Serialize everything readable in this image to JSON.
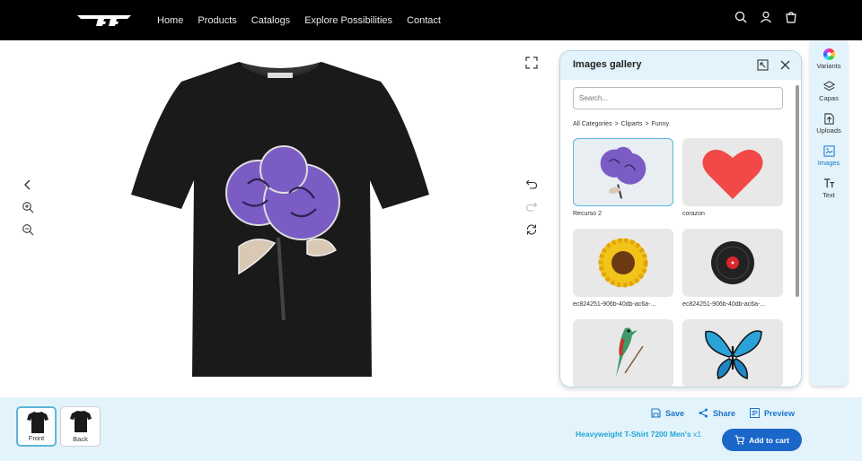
{
  "header": {
    "nav": [
      "Home",
      "Products",
      "Catalogs",
      "Explore Possibilities",
      "Contact"
    ]
  },
  "gallery": {
    "title": "Images gallery",
    "search_placeholder": "Search...",
    "breadcrumb": [
      "All Categories",
      ">",
      "Cliparts",
      ">",
      "Funny"
    ],
    "items": [
      {
        "label": "Recurso 2",
        "icon": "purple-roses-image"
      },
      {
        "label": "corazon",
        "icon": "red-heart-image"
      },
      {
        "label": "ec824251-906b-40db-ac6a-...",
        "icon": "sunflower-image"
      },
      {
        "label": "ec824251-906b-40db-ac6a-...",
        "icon": "vinyl-record-image"
      },
      {
        "label": "",
        "icon": "hummingbird-image"
      },
      {
        "label": "",
        "icon": "blue-butterfly-image"
      }
    ]
  },
  "rail": {
    "items": [
      {
        "label": "Variants",
        "icon": "color-wheel-icon"
      },
      {
        "label": "Capas",
        "icon": "layers-icon"
      },
      {
        "label": "Uploads",
        "icon": "upload-icon"
      },
      {
        "label": "Images",
        "icon": "image-icon"
      },
      {
        "label": "Text",
        "icon": "text-icon"
      }
    ],
    "active": "Images"
  },
  "views": [
    {
      "label": "Front"
    },
    {
      "label": "Back"
    }
  ],
  "actions": {
    "save": "Save",
    "share": "Share",
    "preview": "Preview"
  },
  "product": {
    "name": "Heavyweight T-Shirt 7200 Men's",
    "qty": "x1"
  },
  "cart_label": "Add to cart",
  "colors": {
    "accent": "#1b66c9",
    "panel_bg": "#e3f3fb",
    "header_bg": "#000000",
    "shirt": "#1a1a1a",
    "rose": "#7b5bc4"
  }
}
